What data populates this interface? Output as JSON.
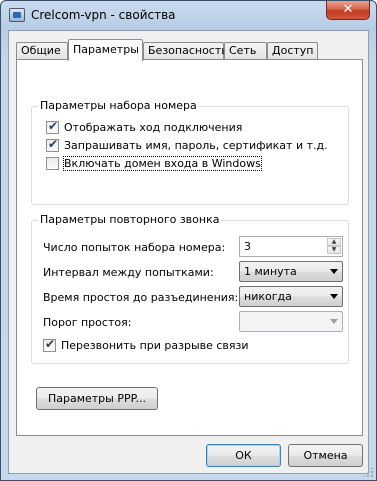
{
  "window": {
    "title": "Crelcom-vpn - свойства",
    "close_glyph": "✕"
  },
  "tabs": [
    {
      "label": "Общие"
    },
    {
      "label": "Параметры"
    },
    {
      "label": "Безопасность"
    },
    {
      "label": "Сеть"
    },
    {
      "label": "Доступ"
    }
  ],
  "dialing": {
    "title": "Параметры набора номера",
    "show_progress": {
      "label": "Отображать ход подключения",
      "checked": true
    },
    "prompt_credentials": {
      "label": "Запрашивать имя, пароль, сертификат и т.д.",
      "checked": true
    },
    "include_domain": {
      "label": "Включать домен входа в Windows",
      "checked": false
    }
  },
  "redial": {
    "title": "Параметры повторного звонка",
    "attempts_label": "Число попыток набора номера:",
    "attempts_value": "3",
    "interval_label": "Интервал между попытками:",
    "interval_value": "1 минута",
    "idle_label": "Время простоя до разъединения:",
    "idle_value": "никогда",
    "threshold_label": "Порог простоя:",
    "threshold_value": "",
    "redial_on_drop": {
      "label": "Перезвонить при разрыве связи",
      "checked": true
    }
  },
  "ppp_button": "Параметры PPP...",
  "footer": {
    "ok": "ОК",
    "cancel": "Отмена"
  },
  "check_glyph": "✔",
  "spin_up": "▲",
  "spin_down": "▼"
}
